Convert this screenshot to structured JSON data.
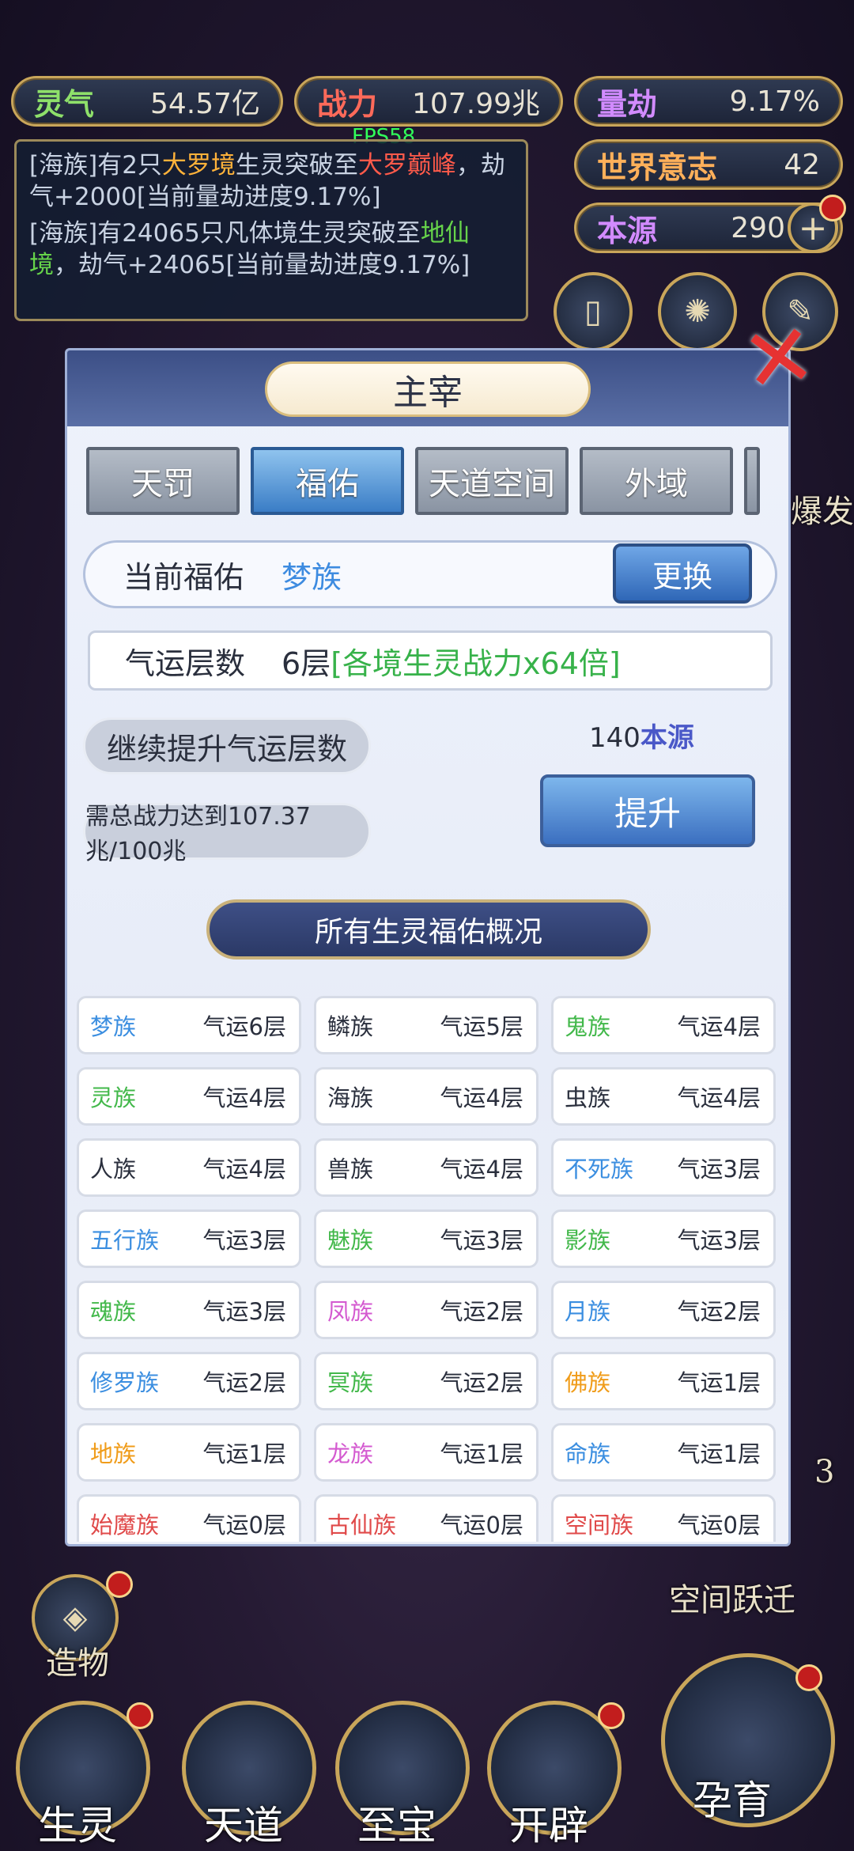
{
  "hud": {
    "lingqi": {
      "label": "灵气",
      "value": "54.57亿"
    },
    "zhanli": {
      "label": "战力",
      "value": "107.99兆"
    },
    "liangjie": {
      "label": "量劫",
      "value": "9.17%"
    },
    "shijie": {
      "label": "世界意志",
      "value": "42"
    },
    "benyuan": {
      "label": "本源",
      "value": "290"
    },
    "fps": "FPS58"
  },
  "log": {
    "line1_a": "[海族]有2只",
    "line1_b": "大罗境",
    "line1_c": "生灵突破至",
    "line1_d": "大罗巅峰",
    "line1_e": "，劫气+2000[当前量劫进度9.17%]",
    "line2_a": "[海族]有24065只凡体境生灵突破至",
    "line2_b": "地仙境",
    "line2_c": "，劫气+24065[当前量劫进度9.17%]"
  },
  "side": {
    "explode": "爆发",
    "space_jump": "空间跃迁",
    "create": "造物",
    "three": "3"
  },
  "panel": {
    "title": "主宰",
    "tabs": [
      "天罚",
      "福佑",
      "天道空间",
      "外域"
    ],
    "current_label": "当前福佑",
    "current_value": "梦族",
    "swap": "更换",
    "luck_label": "气运层数",
    "luck_level": "6层",
    "luck_bonus": "[各境生灵战力x64倍]",
    "continue": "继续提升气运层数",
    "cost_num": "140",
    "cost_unit": "本源",
    "requirement": "需总战力达到107.37兆/100兆",
    "upgrade": "提升",
    "overview": "所有生灵福佑概况"
  },
  "races": [
    {
      "name": "梦族",
      "luck": "气运6层",
      "color": "blue"
    },
    {
      "name": "鳞族",
      "luck": "气运5层",
      "color": "dark"
    },
    {
      "name": "鬼族",
      "luck": "气运4层",
      "color": "green"
    },
    {
      "name": "灵族",
      "luck": "气运4层",
      "color": "green"
    },
    {
      "name": "海族",
      "luck": "气运4层",
      "color": "dark"
    },
    {
      "name": "虫族",
      "luck": "气运4层",
      "color": "dark"
    },
    {
      "name": "人族",
      "luck": "气运4层",
      "color": "dark"
    },
    {
      "name": "兽族",
      "luck": "气运4层",
      "color": "dark"
    },
    {
      "name": "不死族",
      "luck": "气运3层",
      "color": "blue"
    },
    {
      "name": "五行族",
      "luck": "气运3层",
      "color": "blue"
    },
    {
      "name": "魅族",
      "luck": "气运3层",
      "color": "green"
    },
    {
      "name": "影族",
      "luck": "气运3层",
      "color": "green"
    },
    {
      "name": "魂族",
      "luck": "气运3层",
      "color": "green"
    },
    {
      "name": "凤族",
      "luck": "气运2层",
      "color": "pink"
    },
    {
      "name": "月族",
      "luck": "气运2层",
      "color": "blue"
    },
    {
      "name": "修罗族",
      "luck": "气运2层",
      "color": "blue"
    },
    {
      "name": "冥族",
      "luck": "气运2层",
      "color": "green"
    },
    {
      "name": "佛族",
      "luck": "气运1层",
      "color": "orange"
    },
    {
      "name": "地族",
      "luck": "气运1层",
      "color": "orange"
    },
    {
      "name": "龙族",
      "luck": "气运1层",
      "color": "pink"
    },
    {
      "name": "命族",
      "luck": "气运1层",
      "color": "blue"
    },
    {
      "name": "始魔族",
      "luck": "气运0层",
      "color": "red"
    },
    {
      "name": "古仙族",
      "luck": "气运0层",
      "color": "red"
    },
    {
      "name": "空间族",
      "luck": "气运0层",
      "color": "red"
    }
  ],
  "bottom_nav": [
    "生灵",
    "天道",
    "至宝",
    "开辟",
    "孕育"
  ]
}
